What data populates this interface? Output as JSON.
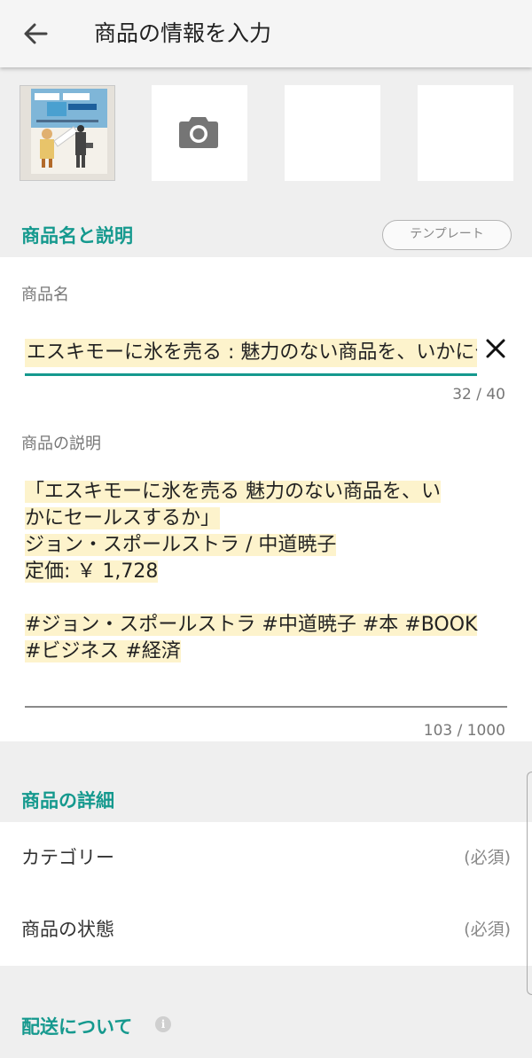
{
  "header": {
    "title": "商品の情報を入力",
    "back_icon": "arrow-left-icon"
  },
  "photos": {
    "slots": [
      {
        "state": "filled",
        "content": "book-cover-thumbnail"
      },
      {
        "state": "empty",
        "icon": "camera-icon"
      },
      {
        "state": "empty"
      },
      {
        "state": "empty"
      }
    ]
  },
  "name_section": {
    "title": "商品名と説明",
    "template_button": "テンプレート"
  },
  "product_name": {
    "label": "商品名",
    "value": "エスキモーに氷を売る : 魅力のない商品を、いかにセールスするか",
    "counter": "32 / 40",
    "clear_icon": "close-icon"
  },
  "product_description": {
    "label": "商品の説明",
    "lines": [
      "「エスキモーに氷を売る 魅力のない商品を、い",
      "かにセールスするか」",
      "ジョン・スポールストラ / 中道暁子",
      "定価: ￥ 1,728",
      "",
      "#ジョン・スポールストラ #中道暁子 #本 #BOOK",
      "#ビジネス #経済"
    ],
    "counter": "103 / 1000"
  },
  "details_section": {
    "title": "商品の詳細",
    "rows": [
      {
        "label": "カテゴリー",
        "value": "(必須)"
      },
      {
        "label": "商品の状態",
        "value": "(必須)"
      }
    ]
  },
  "shipping_section": {
    "title": "配送について",
    "info_icon": "info-icon"
  },
  "colors": {
    "accent": "#15998e",
    "highlight": "#fdf3cc",
    "background": "#efefef"
  }
}
